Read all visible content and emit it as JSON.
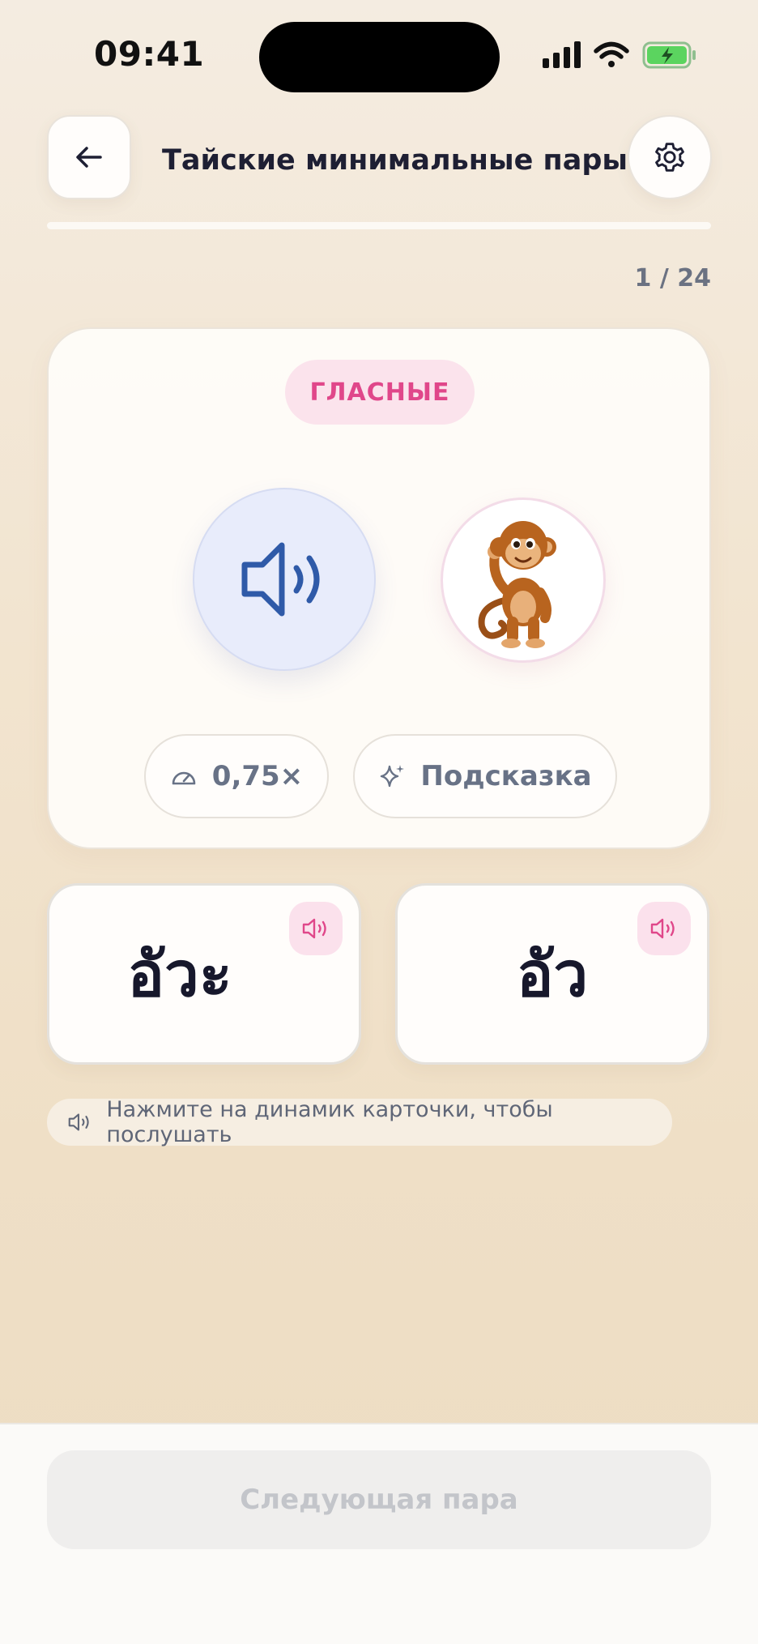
{
  "status_bar": {
    "time": "09:41"
  },
  "header": {
    "title": "Тайские минимальные пары"
  },
  "progress": {
    "current": 1,
    "total": 24,
    "counter_text": "1 / 24",
    "fraction": 0.0
  },
  "card": {
    "category": "ГЛАСНЫЕ",
    "speed_label": "0,75×",
    "hint_label": "Подсказка"
  },
  "choices": [
    {
      "word": "อัวะ"
    },
    {
      "word": "อัว"
    }
  ],
  "hint_text": "Нажмите на динамик карточки, чтобы послушать",
  "footer": {
    "next_label": "Следующая пара"
  },
  "colors": {
    "accent_pink": "#e0478a",
    "play_blue": "#2f5aa8",
    "battery_green": "#5bd45f"
  }
}
